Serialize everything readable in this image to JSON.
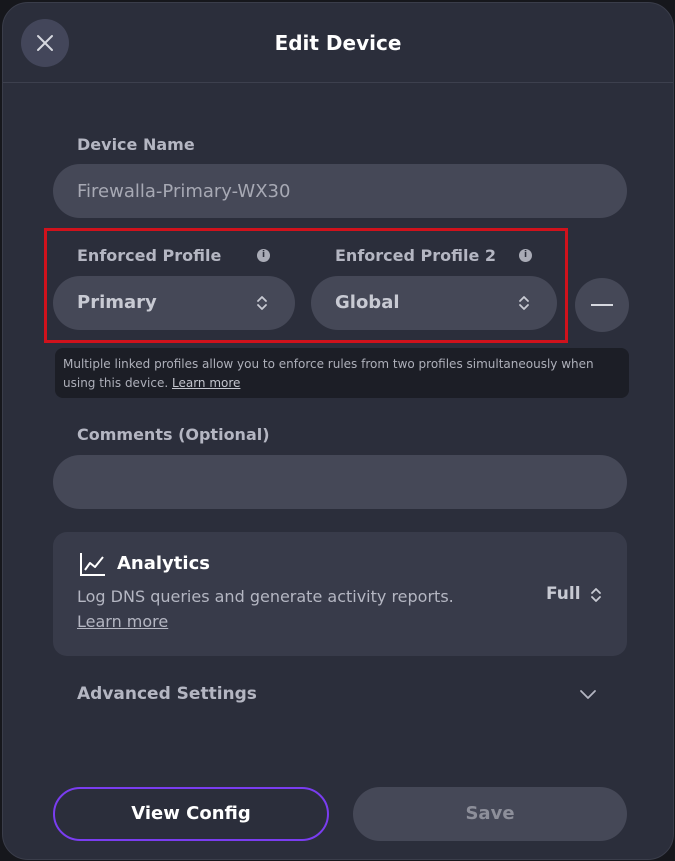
{
  "header": {
    "title": "Edit Device"
  },
  "device_name": {
    "label": "Device Name",
    "value": "Firewalla-Primary-WX30"
  },
  "profiles": {
    "profile1": {
      "label": "Enforced Profile",
      "value": "Primary"
    },
    "profile2": {
      "label": "Enforced Profile 2",
      "value": "Global"
    },
    "info_icon": "i",
    "help_text": "Multiple linked profiles allow you to enforce rules from two profiles simultaneously when using this device.",
    "help_link": "Learn more"
  },
  "comments": {
    "label": "Comments (Optional)",
    "value": ""
  },
  "analytics": {
    "title": "Analytics",
    "description": "Log DNS queries and generate activity reports.",
    "link": "Learn more",
    "level": "Full"
  },
  "advanced": {
    "label": "Advanced Settings"
  },
  "footer": {
    "view_config": "View Config",
    "save": "Save"
  },
  "colors": {
    "accent": "#7a3df0",
    "highlight": "#d0121c",
    "modal_bg": "#2b2e3b"
  },
  "icons": [
    "close-icon",
    "info-icon",
    "chevron-updown-icon",
    "minus-icon",
    "line-chart-icon",
    "chevron-down-icon"
  ]
}
